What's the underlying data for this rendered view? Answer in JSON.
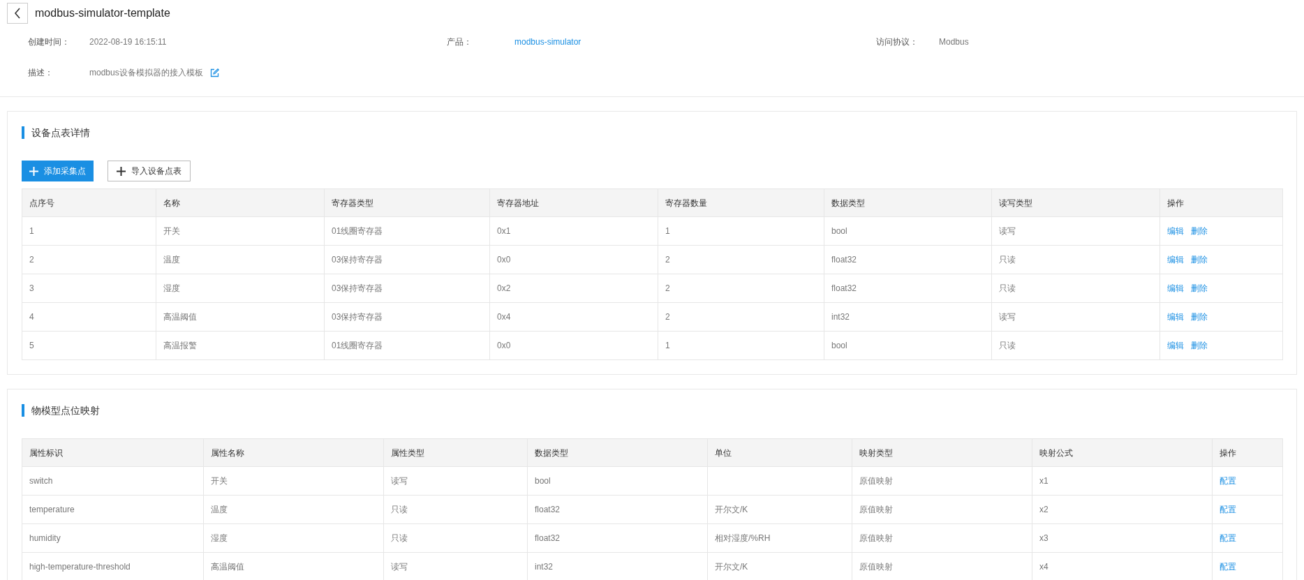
{
  "header": {
    "title": "modbus-simulator-template"
  },
  "info": [
    {
      "label": "创建时间：",
      "value": "2022-08-19 16:15:11",
      "kind": "text"
    },
    {
      "label": "产品：",
      "value": "modbus-simulator",
      "kind": "link"
    },
    {
      "label": "访问协议：",
      "value": "Modbus",
      "kind": "text"
    },
    {
      "label": "描述：",
      "value": "modbus设备模拟器的接入模板",
      "kind": "editable"
    }
  ],
  "point_table": {
    "title": "设备点表详情",
    "buttons": [
      {
        "label": "添加采集点",
        "kind": "primary"
      },
      {
        "label": "导入设备点表",
        "kind": "default"
      }
    ],
    "columns": [
      "点序号",
      "名称",
      "寄存器类型",
      "寄存器地址",
      "寄存器数量",
      "数据类型",
      "读写类型",
      "操作"
    ],
    "rows": [
      {
        "cells": [
          "1",
          "开关",
          "01线圈寄存器",
          "0x1",
          "1",
          "bool",
          "读写"
        ],
        "actions": [
          "编辑",
          "删除"
        ]
      },
      {
        "cells": [
          "2",
          "温度",
          "03保持寄存器",
          "0x0",
          "2",
          "float32",
          "只读"
        ],
        "actions": [
          "编辑",
          "删除"
        ]
      },
      {
        "cells": [
          "3",
          "湿度",
          "03保持寄存器",
          "0x2",
          "2",
          "float32",
          "只读"
        ],
        "actions": [
          "编辑",
          "删除"
        ]
      },
      {
        "cells": [
          "4",
          "高温阈值",
          "03保持寄存器",
          "0x4",
          "2",
          "int32",
          "读写"
        ],
        "actions": [
          "编辑",
          "删除"
        ]
      },
      {
        "cells": [
          "5",
          "高温报警",
          "01线圈寄存器",
          "0x0",
          "1",
          "bool",
          "只读"
        ],
        "actions": [
          "编辑",
          "删除"
        ]
      }
    ]
  },
  "mapping_table": {
    "title": "物模型点位映射",
    "columns": [
      "属性标识",
      "属性名称",
      "属性类型",
      "数据类型",
      "单位",
      "映射类型",
      "映射公式",
      "操作"
    ],
    "rows": [
      {
        "cells": [
          "switch",
          "开关",
          "读写",
          "bool",
          "",
          "原值映射",
          "x1"
        ],
        "actions": [
          "配置"
        ]
      },
      {
        "cells": [
          "temperature",
          "温度",
          "只读",
          "float32",
          "开尔文/K",
          "原值映射",
          "x2"
        ],
        "actions": [
          "配置"
        ]
      },
      {
        "cells": [
          "humidity",
          "湿度",
          "只读",
          "float32",
          "相对湿度/%RH",
          "原值映射",
          "x3"
        ],
        "actions": [
          "配置"
        ]
      },
      {
        "cells": [
          "high-temperature-threshold",
          "高温阈值",
          "读写",
          "int32",
          "开尔文/K",
          "原值映射",
          "x4"
        ],
        "actions": [
          "配置"
        ]
      }
    ]
  }
}
